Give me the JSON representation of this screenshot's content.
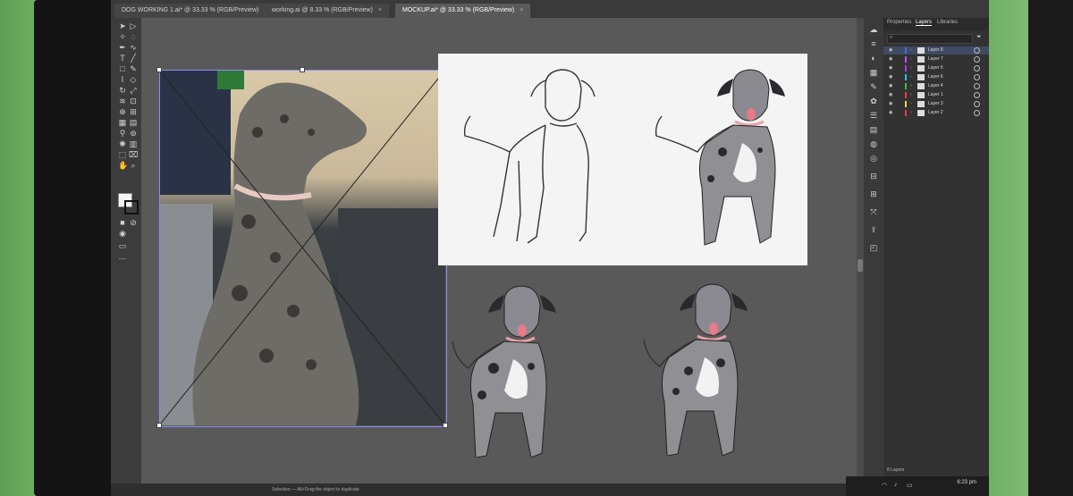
{
  "tabs": [
    {
      "label": "DOG WORKING 1.ai* @ 33.33 % (RGB/Preview)",
      "close": "×"
    },
    {
      "label": "working.ai @ 8.33 % (RGB/Preview)",
      "close": "×"
    },
    {
      "label": "MOCKUP.ai* @ 33.33 % (RGB/Preview)",
      "close": "×"
    }
  ],
  "panel_tabs": [
    "Properties",
    "Layers",
    "Libraries"
  ],
  "layers": [
    {
      "name": "Layer 8",
      "color": "#3b6fff"
    },
    {
      "name": "Layer 7",
      "color": "#c24fff"
    },
    {
      "name": "Layer 5",
      "color": "#b03be8"
    },
    {
      "name": "Layer 6",
      "color": "#20c7e8"
    },
    {
      "name": "Layer 4",
      "color": "#3ac040"
    },
    {
      "name": "Layer 1",
      "color": "#e83b3b"
    },
    {
      "name": "Layer 3",
      "color": "#e0e03b"
    },
    {
      "name": "Layer 2",
      "color": "#e83b3b"
    }
  ],
  "panel_footer": "8 Layers",
  "status": {
    "text": "Selection — Alt+Drag the object to duplicate"
  },
  "clock": {
    "time": "6:23 pm"
  },
  "icons": {
    "eye": "eye-icon",
    "arrow": "chevron-right-icon",
    "search": "search-icon",
    "filter": "filter-icon"
  }
}
